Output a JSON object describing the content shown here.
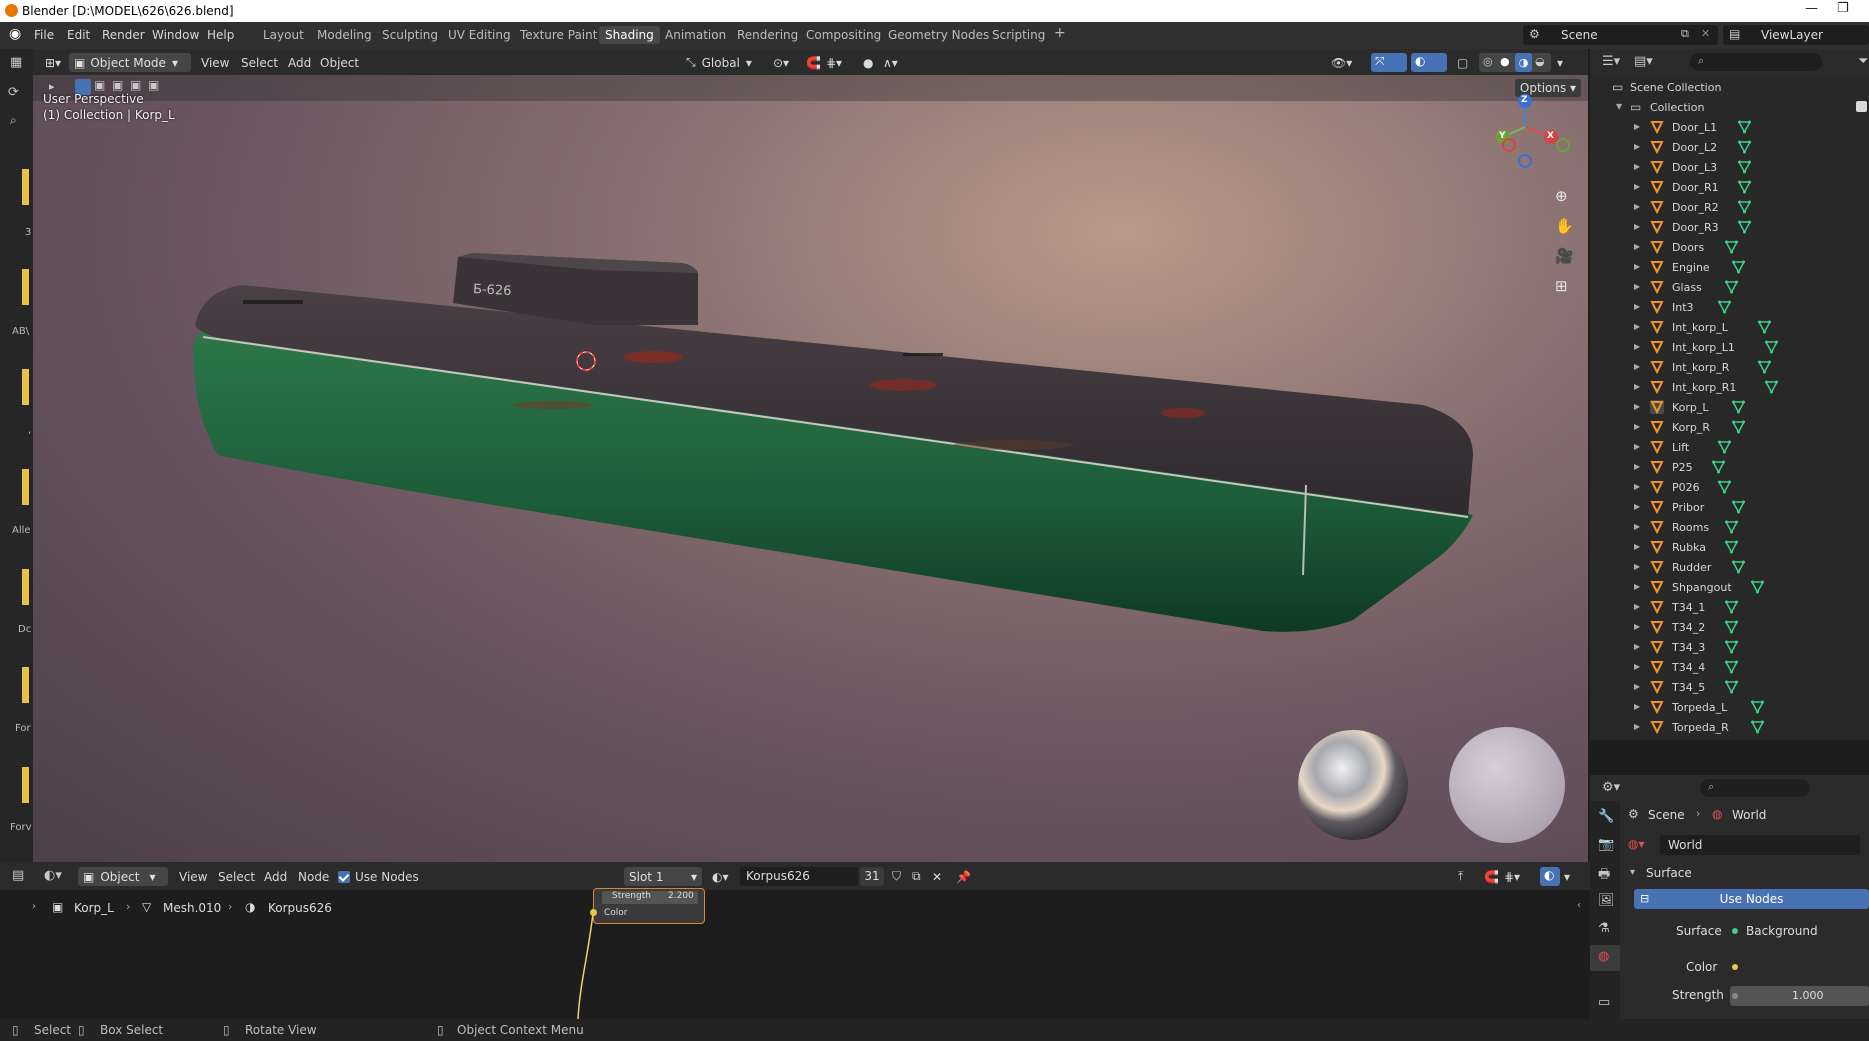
{
  "window": {
    "title": "Blender [D:\\MODEL\\626\\626.blend]"
  },
  "menu": {
    "items": [
      "File",
      "Edit",
      "Render",
      "Window",
      "Help"
    ]
  },
  "workspaces": {
    "tabs": [
      "Layout",
      "Modeling",
      "Sculpting",
      "UV Editing",
      "Texture Paint",
      "Shading",
      "Animation",
      "Rendering",
      "Compositing",
      "Geometry Nodes",
      "Scripting"
    ],
    "active": "Shading"
  },
  "scene": {
    "name": "Scene",
    "view_layer": "ViewLayer"
  },
  "viewport_header": {
    "mode": "Object Mode",
    "view": "View",
    "select": "Select",
    "add": "Add",
    "object": "Object",
    "orientation": "Global",
    "options": "Options"
  },
  "viewport": {
    "perspective": "User Perspective",
    "collection_info": "(1) Collection | Korp_L",
    "hull_marking": "Б-626",
    "gizmo": {
      "z": "Z",
      "y": "Y",
      "x": "X"
    }
  },
  "left_strip": {
    "labels": [
      "3",
      "AB\\",
      ",",
      "Alle",
      "Dc",
      "For",
      "Forv"
    ]
  },
  "outliner": {
    "scene_collection": "Scene Collection",
    "collection": "Collection",
    "objects": [
      "Door_L1",
      "Door_L2",
      "Door_L3",
      "Door_R1",
      "Door_R2",
      "Door_R3",
      "Doors",
      "Engine",
      "Glass",
      "Int3",
      "Int_korp_L",
      "Int_korp_L1",
      "Int_korp_R",
      "Int_korp_R1",
      "Korp_L",
      "Korp_R",
      "Lift",
      "P25",
      "P026",
      "Pribor",
      "Rooms",
      "Rubka",
      "Rudder",
      "Shpangout",
      "T34_1",
      "T34_2",
      "T34_3",
      "T34_4",
      "T34_5",
      "Torpeda_L",
      "Torpeda_R"
    ],
    "selected": "Korp_L"
  },
  "properties": {
    "breadcrumb_scene": "Scene",
    "breadcrumb_world": "World",
    "world_name": "World",
    "panel": "Surface",
    "use_nodes": "Use Nodes",
    "surface_label": "Surface",
    "surface_value": "Background",
    "color_label": "Color",
    "strength_label": "Strength",
    "strength_value": "1.000"
  },
  "node_editor": {
    "type": "Object",
    "view": "View",
    "select": "Select",
    "add": "Add",
    "node": "Node",
    "use_nodes": "Use Nodes",
    "slot": "Slot 1",
    "material": "Korpus626",
    "users": "31",
    "breadcrumb": [
      "Korp_L",
      "Mesh.010",
      "Korpus626"
    ],
    "node_strength_label": "Strength",
    "node_strength_value": "2.200",
    "node_color_label": "Color"
  },
  "status": {
    "select": "Select",
    "box_select": "Box Select",
    "rotate": "Rotate View",
    "context": "Object Context Menu"
  },
  "colors": {
    "accent": "#4772b3",
    "active_orange": "#ea7600",
    "mesh_icon": "#3ccf8a",
    "obj_icon": "#f0932b"
  }
}
